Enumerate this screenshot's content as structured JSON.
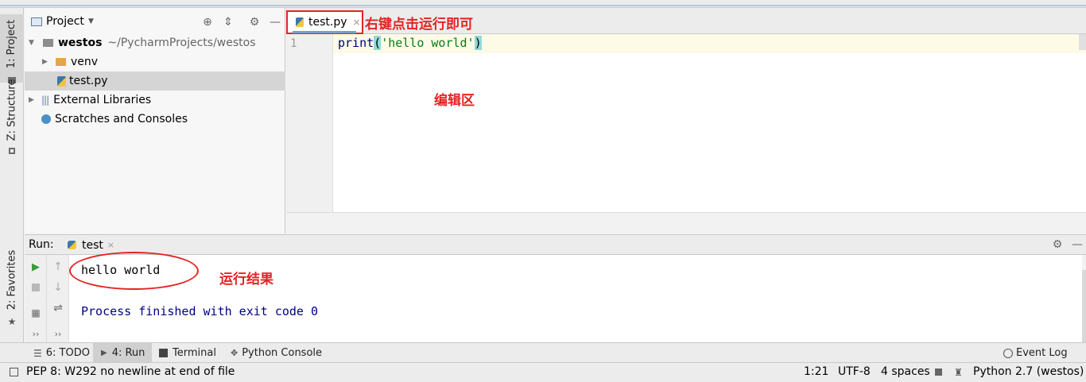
{
  "left_strip": {
    "project_tab": "1: Project",
    "structure_tab": "Z: Structure",
    "favorites_tab": "2: Favorites"
  },
  "project_panel": {
    "title": "Project",
    "tree": {
      "root_name": "westos",
      "root_path": "~/PycharmProjects/westos",
      "venv": "venv",
      "file": "test.py",
      "external": "External Libraries",
      "scratches": "Scratches and Consoles"
    }
  },
  "editor": {
    "tab_label": "test.py",
    "line_number": "1",
    "code": {
      "func": "print",
      "open_paren": "(",
      "string": "'hello world'",
      "close_paren": ")"
    }
  },
  "run_panel": {
    "label": "Run:",
    "tab_label": "test",
    "output_line1": "hello world",
    "output_line2": "Process finished with exit code 0"
  },
  "bottom_tabs": {
    "todo": "6: TODO",
    "run": "4: Run",
    "terminal": "Terminal",
    "python_console": "Python Console",
    "event_log": "Event Log"
  },
  "status_bar": {
    "message": "PEP 8: W292 no newline at end of file",
    "position": "1:21",
    "encoding": "UTF-8",
    "indent": "4 spaces",
    "interpreter": "Python 2.7 (westos)"
  },
  "annotations": {
    "run_hint": "右键点击运行即可",
    "editor_area": "编辑区",
    "result": "运行结果"
  },
  "colors": {
    "annotation_red": "#e52323",
    "string_green": "#067d17",
    "keyword_navy": "#000080",
    "bracket_highlight": "#93d9d9"
  }
}
